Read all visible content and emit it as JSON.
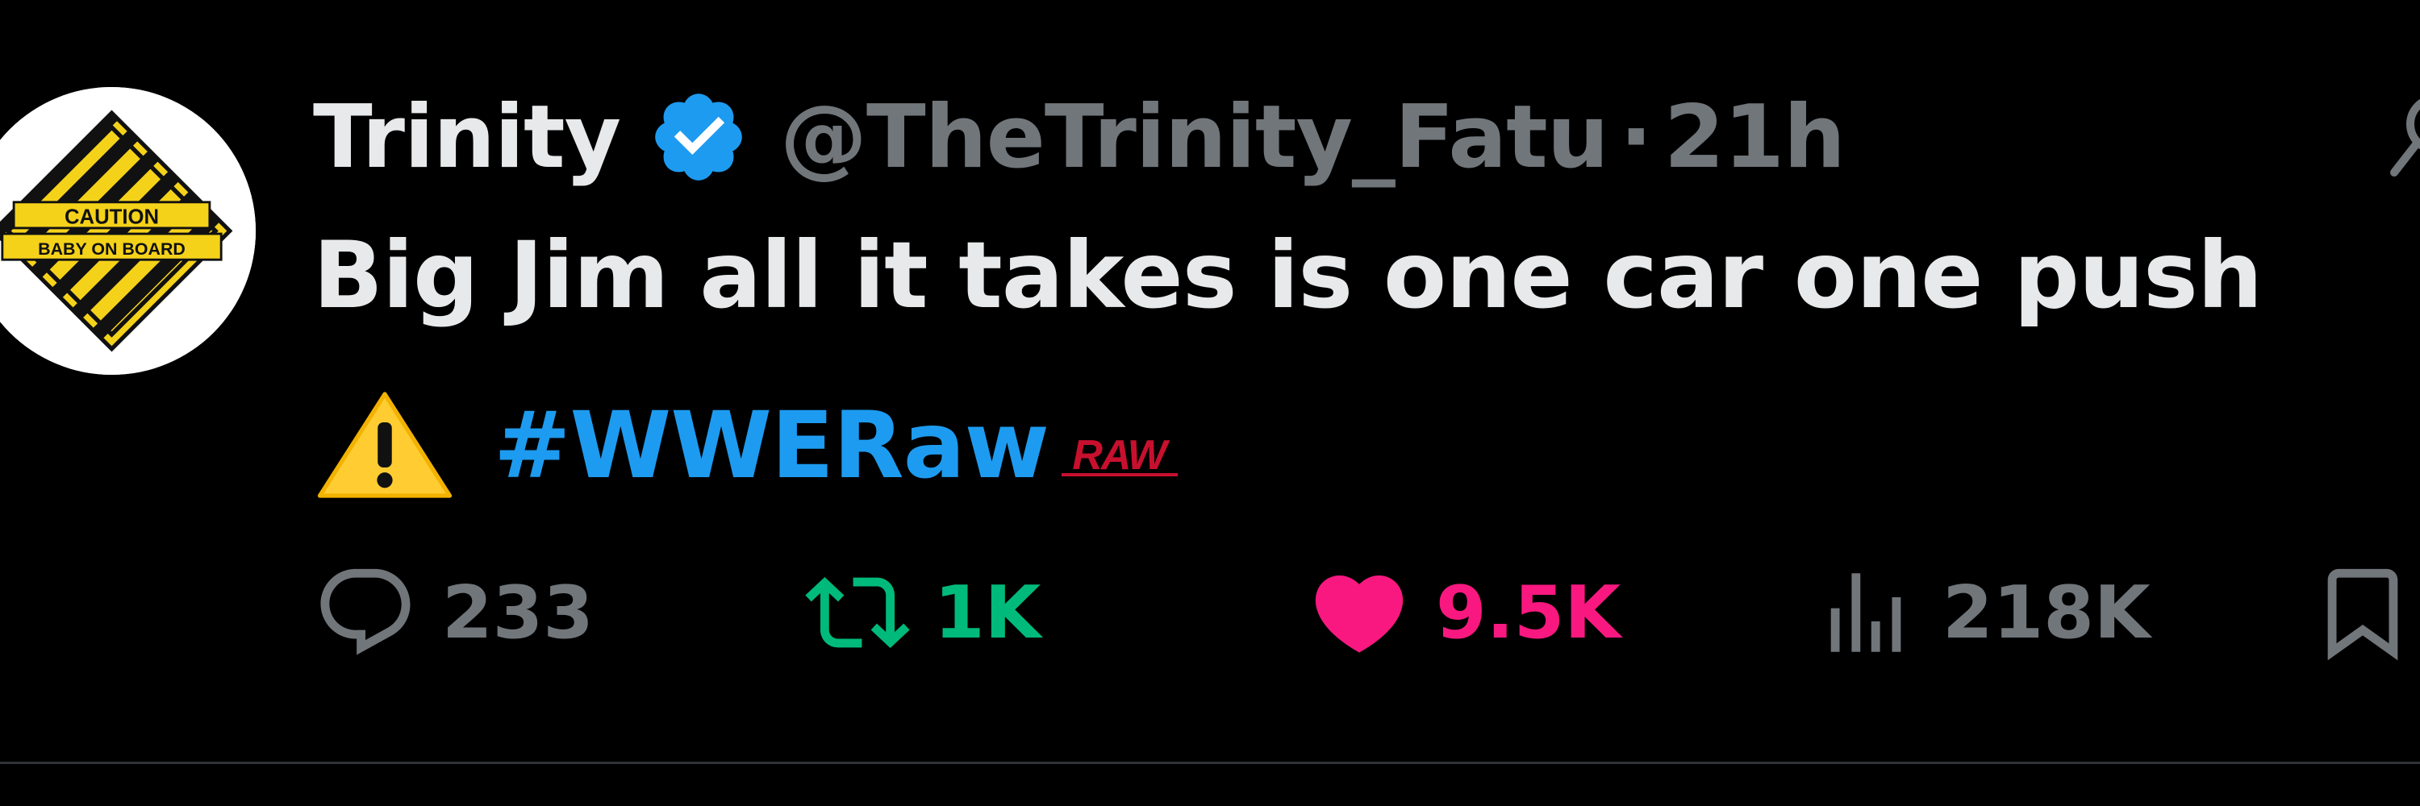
{
  "tweet": {
    "display_name": "Trinity",
    "handle": "@TheTrinity_Fatu",
    "separator": "·",
    "timestamp": "21h",
    "verified": true,
    "avatar": {
      "sign_line1": "CAUTION",
      "sign_line2": "BABY ON BOARD"
    },
    "text": "Big Jim all it takes is one car one push",
    "emoji": "warning-emoji",
    "hashtag": "#WWERaw",
    "hashflag_text": "RAW"
  },
  "actions": {
    "replies": "233",
    "reposts": "1K",
    "likes": "9.5K",
    "views": "218K"
  },
  "colors": {
    "background": "#000000",
    "text_primary": "#e7e9ea",
    "text_secondary": "#71767b",
    "link": "#1d9bf0",
    "repost_active": "#00ba7c",
    "like_active": "#f91880",
    "verified_badge": "#1d9bf0",
    "hashflag_red": "#c8102e"
  },
  "icons": {
    "reply": "reply-icon",
    "repost": "repost-icon",
    "like": "heart-icon",
    "views": "views-icon",
    "bookmark": "bookmark-icon",
    "verified": "verified-badge-icon",
    "grok": "grok-icon"
  }
}
